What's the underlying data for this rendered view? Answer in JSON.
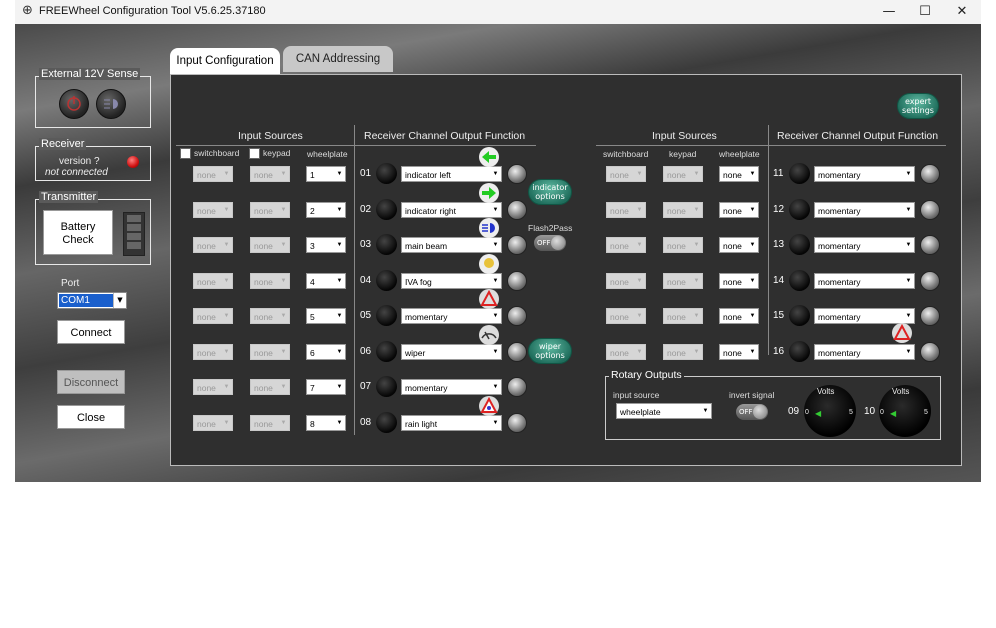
{
  "window": {
    "title": "FREEWheel Configuration Tool V5.6.25.37180",
    "minimize": "—",
    "maximize": "☐",
    "close": "✕"
  },
  "sidebar": {
    "ext_sense_label": "External 12V Sense",
    "receiver_label": "Receiver",
    "receiver_version": "version ?",
    "receiver_status": "not connected",
    "transmitter_label": "Transmitter",
    "battery_check_line1": "Battery",
    "battery_check_line2": "Check",
    "port_label": "Port",
    "port_value": "COM1",
    "connect_label": "Connect",
    "disconnect_label": "Disconnect",
    "close_label": "Close"
  },
  "tabs": [
    {
      "label": "Input Configuration",
      "active": true
    },
    {
      "label": "CAN Addressing",
      "active": false
    }
  ],
  "panel": {
    "expert_settings": "expert settings",
    "input_sources_header": "Input Sources",
    "output_function_header": "Receiver Channel Output Function",
    "col_switchboard": "switchboard",
    "col_keypad": "keypad",
    "col_wheelplate": "wheelplate",
    "indicator_options": "indicator options",
    "flash2pass_label": "Flash2Pass",
    "toggle_off": "OFF",
    "wiper_options": "wiper options",
    "none_value": "none"
  },
  "left_channels": [
    {
      "num": "01",
      "wheelplate": "1",
      "function": "indicator left",
      "icon": "arrow-left-icon"
    },
    {
      "num": "02",
      "wheelplate": "2",
      "function": "indicator right",
      "icon": "arrow-right-icon"
    },
    {
      "num": "03",
      "wheelplate": "3",
      "function": "main beam",
      "icon": "headlight-icon"
    },
    {
      "num": "04",
      "wheelplate": "4",
      "function": "IVA fog",
      "icon": "fog-light-icon"
    },
    {
      "num": "05",
      "wheelplate": "5",
      "function": "momentary",
      "icon": "hazard-icon"
    },
    {
      "num": "06",
      "wheelplate": "6",
      "function": "wiper",
      "icon": "wiper-icon"
    },
    {
      "num": "07",
      "wheelplate": "7",
      "function": "momentary",
      "icon": ""
    },
    {
      "num": "08",
      "wheelplate": "8",
      "function": "rain light",
      "icon": "rain-light-icon"
    }
  ],
  "right_channels": [
    {
      "num": "11",
      "wheelplate": "none",
      "function": "momentary"
    },
    {
      "num": "12",
      "wheelplate": "none",
      "function": "momentary"
    },
    {
      "num": "13",
      "wheelplate": "none",
      "function": "momentary"
    },
    {
      "num": "14",
      "wheelplate": "none",
      "function": "momentary"
    },
    {
      "num": "15",
      "wheelplate": "none",
      "function": "momentary"
    },
    {
      "num": "16",
      "wheelplate": "none",
      "function": "momentary"
    }
  ],
  "rotary": {
    "title": "Rotary Outputs",
    "input_source_label": "input source",
    "input_source_value": "wheelplate",
    "invert_signal_label": "invert signal",
    "dial1_num": "09",
    "dial2_num": "10",
    "dial_label": "Volts",
    "dial_min": "0",
    "dial_max": "5"
  },
  "colors": {
    "accent_green": "#2e8b70",
    "receiver_led": "#e02020"
  }
}
